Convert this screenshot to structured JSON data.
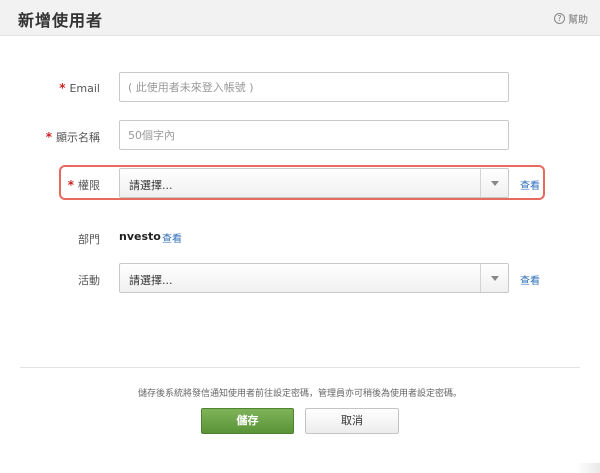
{
  "header": {
    "title": "新增使用者",
    "help_label": "幫助",
    "help_icon": "?"
  },
  "form": {
    "email": {
      "required_mark": "*",
      "label": "Email",
      "value": "",
      "placeholder": "( 此使用者未來登入帳號 )"
    },
    "display_name": {
      "required_mark": "*",
      "label": "顯示名稱",
      "value": "",
      "placeholder": "50個字內"
    },
    "role": {
      "required_mark": "*",
      "label": "權限",
      "selected": "請選擇...",
      "view_link": "查看"
    },
    "department": {
      "label": "部門",
      "value": "nvesto",
      "view_link": "查看"
    },
    "activity": {
      "label": "活動",
      "selected": "請選擇...",
      "view_link": "查看"
    }
  },
  "footer": {
    "notice": "儲存後系統將發信通知使用者前往設定密碼，管理員亦可稍後為使用者設定密碼。",
    "save_label": "儲存",
    "cancel_label": "取消"
  },
  "colors": {
    "required": "#cc2222",
    "link": "#2d6db8",
    "save_button": "#6aa446",
    "highlight": "#e8695e"
  }
}
